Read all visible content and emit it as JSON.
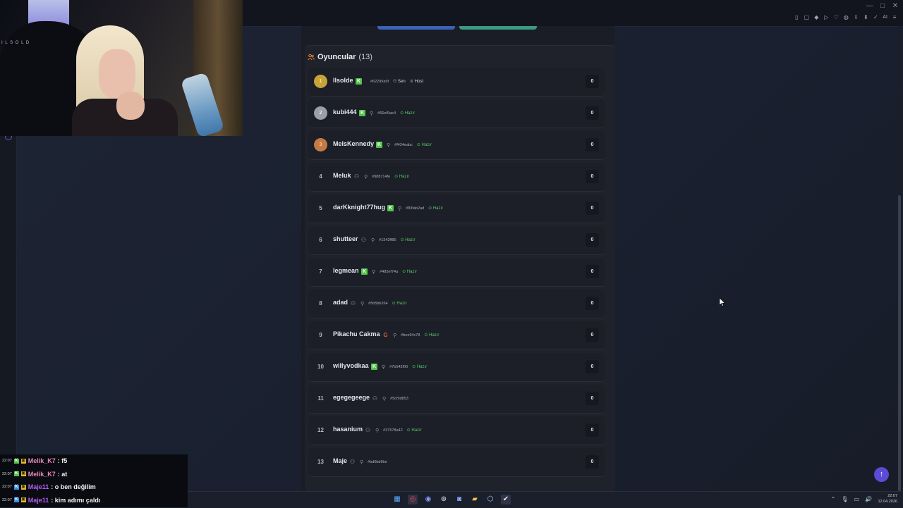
{
  "browser": {
    "window_controls": [
      "—",
      "□",
      "✕"
    ],
    "extensions": [
      "▯",
      "▢",
      "◆",
      "▷",
      "♡",
      "◍",
      "⇩",
      "⬇",
      "✓",
      "AI",
      "≡"
    ]
  },
  "webcam": {
    "overlay_text": "I L S O L D"
  },
  "actions": {
    "primary_label": "",
    "secondary_label": ""
  },
  "players": {
    "title": "Oyuncular",
    "count": "(13)",
    "rows": [
      {
        "rank": "1",
        "name": "Ilsolde",
        "provider": "kick",
        "role_icon": "person",
        "hash": "#62299a9f",
        "tags": [
          "Sen",
          "Host"
        ],
        "score": "0"
      },
      {
        "rank": "2",
        "name": "kubi444",
        "provider": "kick",
        "role_icon": "pin",
        "hash": "#66ef9ae4",
        "tags": [
          "Hazır"
        ],
        "score": "0"
      },
      {
        "rank": "3",
        "name": "MelsKennedy",
        "provider": "kick",
        "role_icon": "pin",
        "hash": "#f434eabc",
        "tags": [
          "Hazır"
        ],
        "score": "0"
      },
      {
        "rank": "4",
        "name": "Meluk",
        "provider": "user",
        "role_icon": "pin",
        "hash": "#988714fe",
        "tags": [
          "Hazır"
        ],
        "score": "0"
      },
      {
        "rank": "5",
        "name": "darKknight77hug",
        "provider": "kick",
        "role_icon": "pin",
        "hash": "#83fab2ad",
        "tags": [
          "Hazır"
        ],
        "score": "0"
      },
      {
        "rank": "6",
        "name": "shutteer",
        "provider": "user",
        "role_icon": "pin",
        "hash": "#1342ff85",
        "tags": [
          "Hazır"
        ],
        "score": "0"
      },
      {
        "rank": "7",
        "name": "legmean",
        "provider": "kick",
        "role_icon": "pin",
        "hash": "#482ef74a",
        "tags": [
          "Hazır"
        ],
        "score": "0"
      },
      {
        "rank": "8",
        "name": "adad",
        "provider": "user",
        "role_icon": "pin",
        "hash": "#5b5bb264",
        "tags": [
          "Hazır"
        ],
        "score": "0"
      },
      {
        "rank": "9",
        "name": "Pikachu Cakma",
        "provider": "google",
        "role_icon": "pin",
        "hash": "#bee94c78",
        "tags": [
          "Hazır"
        ],
        "score": "0"
      },
      {
        "rank": "10",
        "name": "willyvodkaa",
        "provider": "kick",
        "role_icon": "pin",
        "hash": "#7b543f06",
        "tags": [
          "Hazır"
        ],
        "score": "0"
      },
      {
        "rank": "11",
        "name": "egegegeege",
        "provider": "user",
        "role_icon": "pin",
        "hash": "#5cf9d853",
        "tags": [],
        "score": "0"
      },
      {
        "rank": "12",
        "name": "hasanium",
        "provider": "user",
        "role_icon": "pin",
        "hash": "#37678a42",
        "tags": [
          "Hazır"
        ],
        "score": "0"
      },
      {
        "rank": "13",
        "name": "Maje",
        "provider": "user",
        "role_icon": "pin",
        "hash": "#bd6bd6be",
        "tags": [],
        "score": "0"
      }
    ]
  },
  "fab_icon": "↑",
  "chat": {
    "messages": [
      {
        "time": "22:07",
        "user": "Melik_K7",
        "text": ": f5",
        "color": "pink",
        "badge1": "K",
        "badge1_color": "green"
      },
      {
        "time": "22:07",
        "user": "Melik_K7",
        "text": ": at",
        "color": "pink",
        "badge1": "K",
        "badge1_color": "green"
      },
      {
        "time": "22:07",
        "user": "Maje11",
        "text": ": o ben değilim",
        "color": "purple",
        "badge1": "K",
        "badge1_color": "blue"
      },
      {
        "time": "22:07",
        "user": "Maje11",
        "text": ": kim adımı çaldı",
        "color": "purple",
        "badge1": "K",
        "badge1_color": "blue"
      }
    ]
  },
  "taskbar": {
    "apps": [
      "▦",
      "◎",
      "◉",
      "⊛",
      "◙",
      "▰",
      "⬡",
      "✔"
    ],
    "tray": [
      "⌃",
      "🎙",
      "▭",
      "🔊"
    ],
    "time": "22:07",
    "date": "12.04.2026"
  }
}
